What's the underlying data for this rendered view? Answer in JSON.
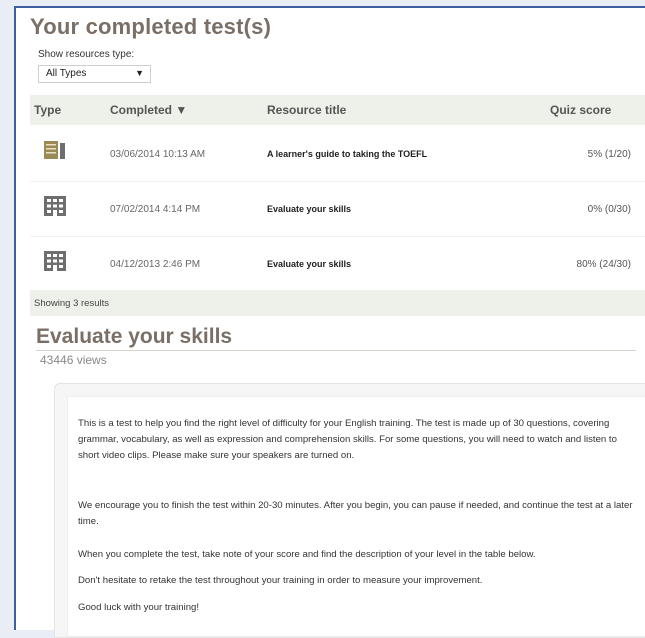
{
  "page": {
    "title": "Your completed test(s)",
    "filter": {
      "label": "Show resources type:",
      "selected": "All Types",
      "arrow": "▼"
    }
  },
  "table": {
    "headers": {
      "type": "Type",
      "completed": "Completed ▼",
      "resource": "Resource title",
      "score": "Quiz score"
    },
    "rows": [
      {
        "icon": "book-icon",
        "date": "03/06/2014 10:13 AM",
        "resource": "A learner's guide to taking the TOEFL",
        "score": "5% (1/20)"
      },
      {
        "icon": "building-icon",
        "date": "07/02/2014 4:14 PM",
        "resource": "Evaluate your skills",
        "score": "0% (0/30)"
      },
      {
        "icon": "building-icon",
        "date": "04/12/2013 2:46 PM",
        "resource": "Evaluate your skills",
        "score": "80% (24/30)"
      }
    ],
    "footer": "Showing 3 results"
  },
  "section": {
    "title": "Evaluate your skills",
    "views": "43446 views",
    "paragraphs": [
      "This is a test to help you find the right level of difficulty for your English training. The test is made up of 30 questions, covering grammar, vocabulary, as well as expression and comprehension skills. For some questions, you will need to watch and listen to short video clips. Please make sure your speakers are turned on.",
      "We encourage you to finish the test within 20-30 minutes. After you begin, you can pause if needed, and continue the test at a later time.",
      "When you complete the test, take note of your score and find the description of your level in the table below.",
      "Don't hesitate to retake the test throughout your training in order to measure your improvement.",
      "Good luck with your training!"
    ]
  },
  "colors": {
    "heading": "#7a6f66",
    "header_bg": "#eef1e9",
    "icon": "#6e6e6e",
    "book_icon": "#9a8a56",
    "frame_border": "#3e5fa0"
  }
}
